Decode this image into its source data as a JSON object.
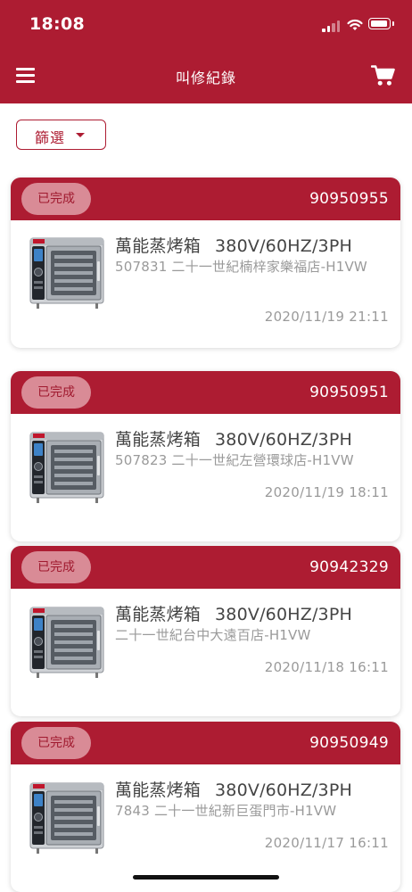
{
  "status_bar": {
    "time": "18:08"
  },
  "header": {
    "title": "叫修紀錄",
    "menu_icon": "hamburger-menu-icon",
    "cart_icon": "shopping-cart-icon"
  },
  "filter": {
    "label": "篩選",
    "icon": "caret-down-icon"
  },
  "records": [
    {
      "status": "已完成",
      "order_no": "90950955",
      "product": "萬能蒸烤箱",
      "model": "380V/60HZ/3PH",
      "location": "507831 二十一世紀楠梓家樂福店-H1VW",
      "time": "2020/11/19 21:11"
    },
    {
      "status": "已完成",
      "order_no": "90950951",
      "product": "萬能蒸烤箱",
      "model": "380V/60HZ/3PH",
      "location": "507823 二十一世紀左營環球店-H1VW",
      "time": "2020/11/19 18:11"
    },
    {
      "status": "已完成",
      "order_no": "90942329",
      "product": "萬能蒸烤箱",
      "model": "380V/60HZ/3PH",
      "location": "二十一世紀台中大遠百店-H1VW",
      "time": "2020/11/18 16:11"
    },
    {
      "status": "已完成",
      "order_no": "90950949",
      "product": "萬能蒸烤箱",
      "model": "380V/60HZ/3PH",
      "location": "7843 二十一世紀新巨蛋門市-H1VW",
      "time": "2020/11/17 16:11"
    }
  ],
  "colors": {
    "brand": "#ad1c32",
    "badge_bg": "#d98b96",
    "muted_text": "#9a9a9a"
  }
}
